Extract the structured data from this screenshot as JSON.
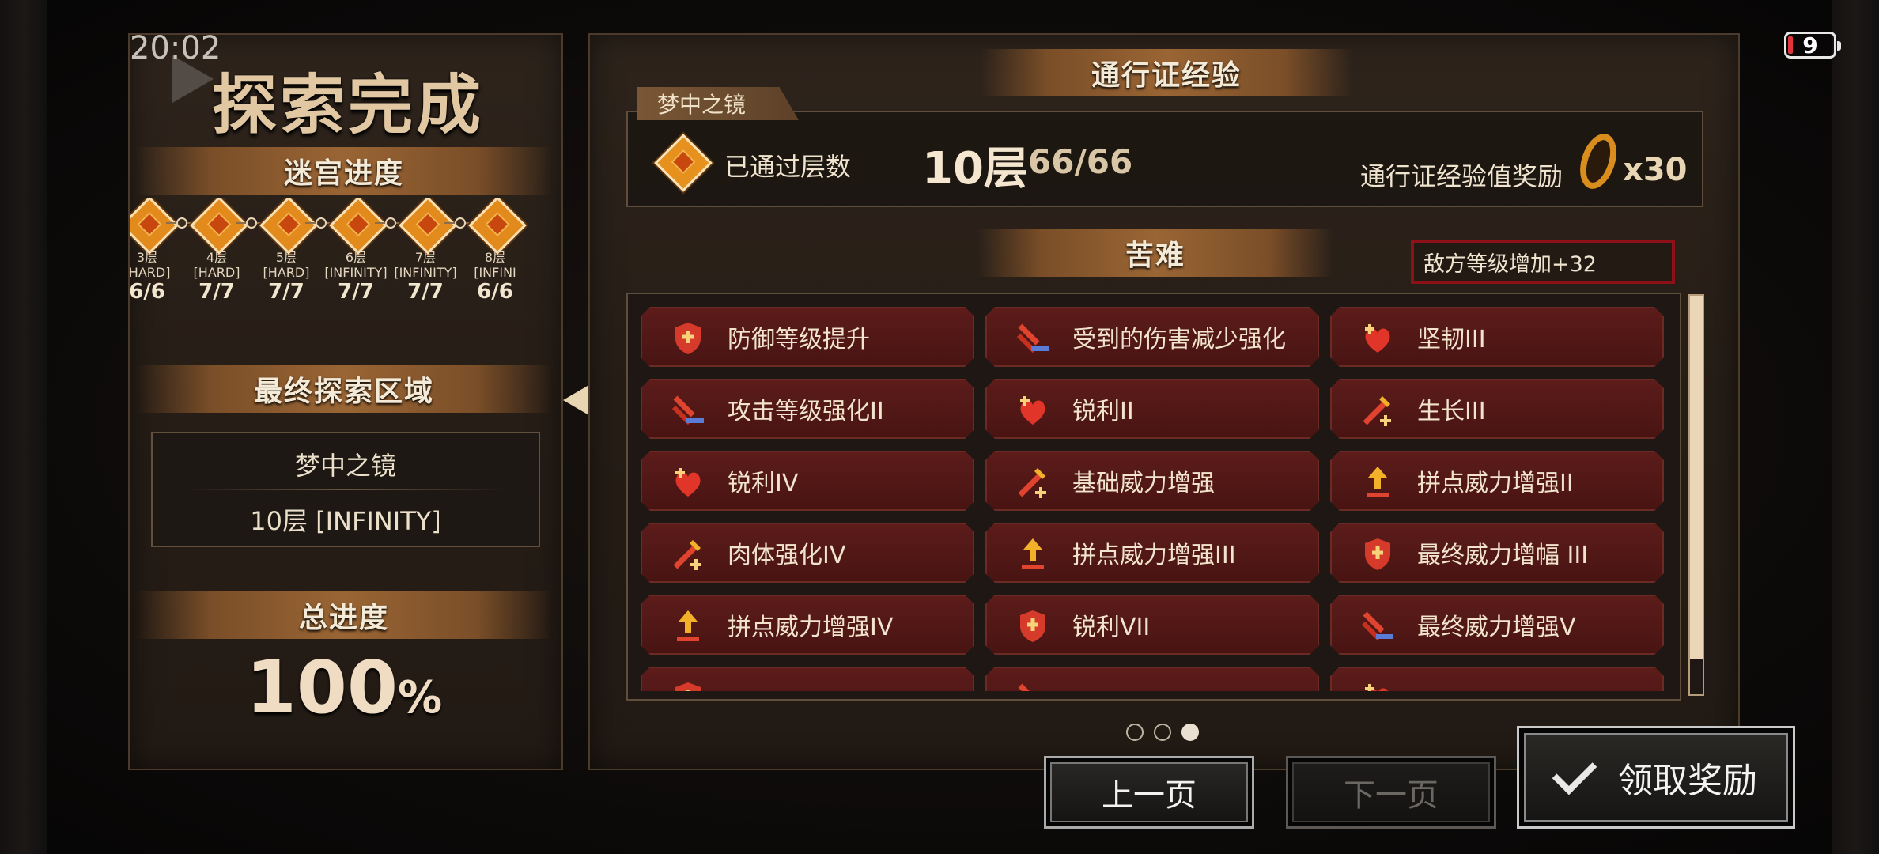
{
  "status_bar": {
    "time": "20:02",
    "battery": "9"
  },
  "left_panel": {
    "title": "探索完成",
    "labyrinth_progress_title": "迷宫进度",
    "nodes": [
      {
        "floor": "3层",
        "mode": "[HARD]",
        "count": "6/6"
      },
      {
        "floor": "4层",
        "mode": "[HARD]",
        "count": "7/7"
      },
      {
        "floor": "5层",
        "mode": "[HARD]",
        "count": "7/7"
      },
      {
        "floor": "6层",
        "mode": "[INFINITY]",
        "count": "7/7"
      },
      {
        "floor": "7层",
        "mode": "[INFINITY]",
        "count": "7/7"
      },
      {
        "floor": "8层",
        "mode": "[INFINI",
        "count": "6/6"
      }
    ],
    "final_area_title": "最终探索区域",
    "final_area_name": "梦中之镜",
    "final_area_floor": "10层 [INFINITY]",
    "total_progress_title": "总进度",
    "total_progress_value": "100",
    "total_progress_unit": "%"
  },
  "right_panel": {
    "pass_exp_title": "通行证经验",
    "dungeon_tag": "梦中之镜",
    "cleared_floors_label": "已通过层数",
    "cleared_floor_value": "10层",
    "cleared_count": "66/66",
    "pass_exp_reward_label": "通行证经验值奖励",
    "pass_exp_reward_value": "x30",
    "hardship_title": "苦难",
    "enemy_level_note": "敌方等级增加+32",
    "hardships": [
      [
        "防御等级提升",
        "受到的伤害减少强化",
        "坚韧III"
      ],
      [
        "攻击等级强化II",
        "锐利II",
        "生长III"
      ],
      [
        "锐利IV",
        "基础威力增强",
        "拼点威力增强II"
      ],
      [
        "肉体强化IV",
        "拼点威力增强III",
        "最终威力增幅 III"
      ],
      [
        "拼点威力增强IV",
        "锐利VII",
        "最终威力增强V"
      ]
    ],
    "pager": {
      "pages": 3,
      "current": 3
    }
  },
  "buttons": {
    "prev": "上一页",
    "next": "下一页",
    "claim": "领取奖励"
  },
  "colors": {
    "card_bg": "#5c1c1a",
    "accent_gold": "#e6901e",
    "warning_border": "#8d1117"
  },
  "icons": [
    "shield-up-icon",
    "damage-reduce-icon",
    "heart-plus-icon",
    "sword-up-icon",
    "arrow-up-icon"
  ]
}
